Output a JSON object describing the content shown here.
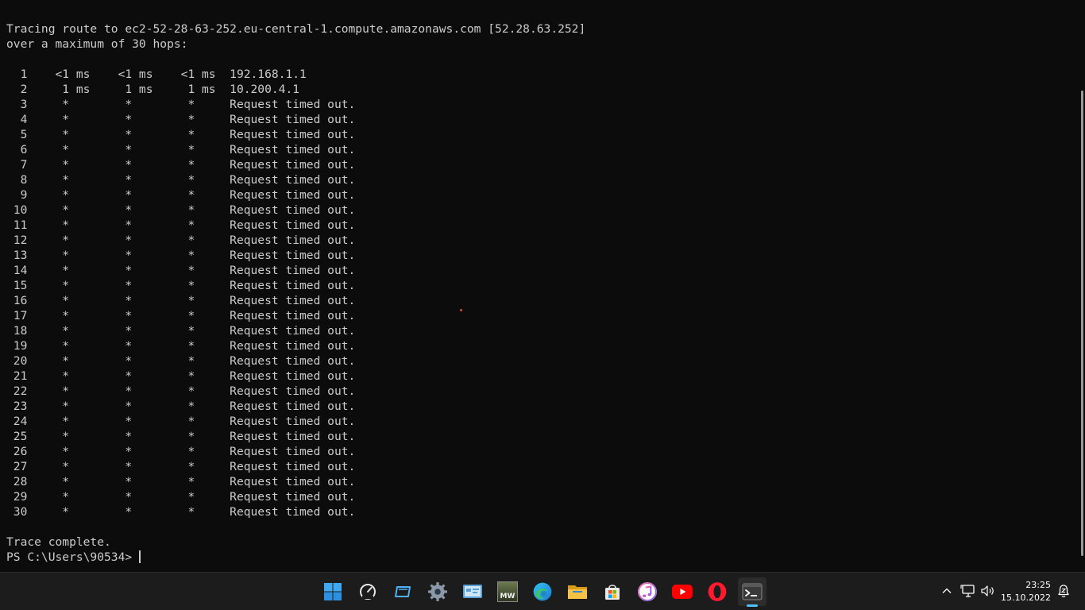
{
  "terminal": {
    "lines": [
      "Tracing route to ec2-52-28-63-252.eu-central-1.compute.amazonaws.com [52.28.63.252]",
      "over a maximum of 30 hops:",
      "",
      "  1    <1 ms    <1 ms    <1 ms  192.168.1.1",
      "  2     1 ms     1 ms     1 ms  10.200.4.1",
      "  3     *        *        *     Request timed out.",
      "  4     *        *        *     Request timed out.",
      "  5     *        *        *     Request timed out.",
      "  6     *        *        *     Request timed out.",
      "  7     *        *        *     Request timed out.",
      "  8     *        *        *     Request timed out.",
      "  9     *        *        *     Request timed out.",
      " 10     *        *        *     Request timed out.",
      " 11     *        *        *     Request timed out.",
      " 12     *        *        *     Request timed out.",
      " 13     *        *        *     Request timed out.",
      " 14     *        *        *     Request timed out.",
      " 15     *        *        *     Request timed out.",
      " 16     *        *        *     Request timed out.",
      " 17     *        *        *     Request timed out.",
      " 18     *        *        *     Request timed out.",
      " 19     *        *        *     Request timed out.",
      " 20     *        *        *     Request timed out.",
      " 21     *        *        *     Request timed out.",
      " 22     *        *        *     Request timed out.",
      " 23     *        *        *     Request timed out.",
      " 24     *        *        *     Request timed out.",
      " 25     *        *        *     Request timed out.",
      " 26     *        *        *     Request timed out.",
      " 27     *        *        *     Request timed out.",
      " 28     *        *        *     Request timed out.",
      " 29     *        *        *     Request timed out.",
      " 30     *        *        *     Request timed out.",
      "",
      "Trace complete."
    ],
    "prompt": "PS C:\\Users\\90534>",
    "text_color": "#cccccc",
    "background": "#0c0c0c"
  },
  "taskbar": {
    "apps": [
      {
        "name": "start-button",
        "icon": "windows-logo-icon"
      },
      {
        "name": "speedtest-app",
        "icon": "speedometer-icon"
      },
      {
        "name": "tablet-app",
        "icon": "tablet-icon"
      },
      {
        "name": "settings-app",
        "icon": "gear-icon"
      },
      {
        "name": "control-panel-app",
        "icon": "control-panel-icon"
      },
      {
        "name": "game-app",
        "icon": "game-mw-icon"
      },
      {
        "name": "edge-app",
        "icon": "edge-icon"
      },
      {
        "name": "file-explorer-app",
        "icon": "folder-icon"
      },
      {
        "name": "store-app",
        "icon": "store-bag-icon"
      },
      {
        "name": "itunes-app",
        "icon": "music-note-icon"
      },
      {
        "name": "youtube-app",
        "icon": "youtube-icon"
      },
      {
        "name": "opera-app",
        "icon": "opera-icon"
      },
      {
        "name": "terminal-app",
        "icon": "terminal-icon",
        "active": true
      }
    ],
    "game_icon_text": "MW",
    "tray": {
      "time": "23:25",
      "date": "15.10.2022"
    },
    "accent_color": "#4cc2ff"
  }
}
